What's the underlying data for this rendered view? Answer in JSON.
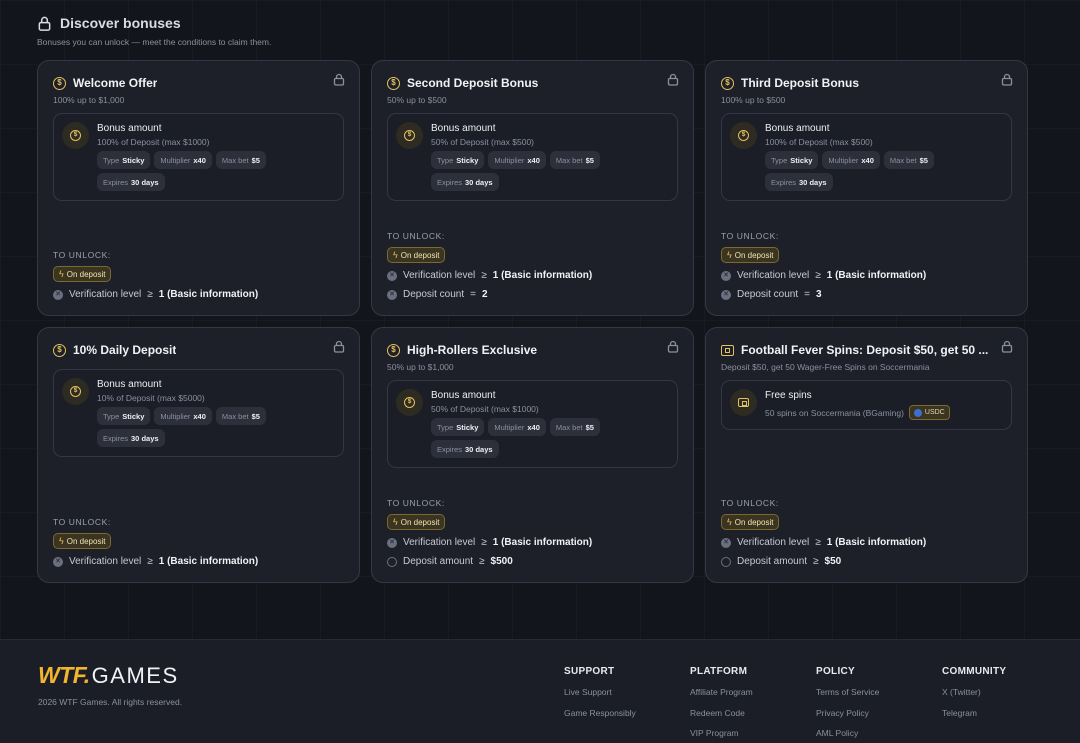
{
  "header": {
    "title": "Discover bonuses",
    "subtitle": "Bonuses you can unlock — meet the conditions to claim them."
  },
  "labels": {
    "to_unlock": "TO UNLOCK:",
    "on_deposit": "On deposit",
    "chip_type": "Type",
    "chip_multiplier": "Multiplier",
    "chip_maxbet": "Max bet",
    "chip_expires": "Expires"
  },
  "cards": [
    {
      "title": "Welcome Offer",
      "subtitle": "100% up to $1,000",
      "bonus_label": "Bonus amount",
      "bonus_desc": "100% of Deposit (max $1000)",
      "type": "Sticky",
      "multiplier": "x40",
      "maxbet": "$5",
      "expires": "30 days",
      "conditions": [
        {
          "label": "Verification level",
          "op": "≥",
          "value": "1 (Basic information)",
          "icon": "x-circle-icon"
        }
      ]
    },
    {
      "title": "Second Deposit Bonus",
      "subtitle": "50% up to $500",
      "bonus_label": "Bonus amount",
      "bonus_desc": "50% of Deposit (max $500)",
      "type": "Sticky",
      "multiplier": "x40",
      "maxbet": "$5",
      "expires": "30 days",
      "conditions": [
        {
          "label": "Verification level",
          "op": "≥",
          "value": "1 (Basic information)",
          "icon": "x-circle-icon"
        },
        {
          "label": "Deposit count",
          "op": "=",
          "value": "2",
          "icon": "x-circle-icon"
        }
      ]
    },
    {
      "title": "Third Deposit Bonus",
      "subtitle": "100% up to $500",
      "bonus_label": "Bonus amount",
      "bonus_desc": "100% of Deposit (max $500)",
      "type": "Sticky",
      "multiplier": "x40",
      "maxbet": "$5",
      "expires": "30 days",
      "conditions": [
        {
          "label": "Verification level",
          "op": "≥",
          "value": "1 (Basic information)",
          "icon": "x-circle-icon"
        },
        {
          "label": "Deposit count",
          "op": "=",
          "value": "3",
          "icon": "x-circle-icon"
        }
      ]
    },
    {
      "title": "10% Daily Deposit",
      "subtitle": "",
      "bonus_label": "Bonus amount",
      "bonus_desc": "10% of Deposit (max $5000)",
      "type": "Sticky",
      "multiplier": "x40",
      "maxbet": "$5",
      "expires": "30 days",
      "conditions": [
        {
          "label": "Verification level",
          "op": "≥",
          "value": "1 (Basic information)",
          "icon": "x-circle-icon"
        }
      ]
    },
    {
      "title": "High-Rollers Exclusive",
      "subtitle": "50% up to $1,000",
      "bonus_label": "Bonus amount",
      "bonus_desc": "50% of Deposit (max $1000)",
      "type": "Sticky",
      "multiplier": "x40",
      "maxbet": "$5",
      "expires": "30 days",
      "conditions": [
        {
          "label": "Verification level",
          "op": "≥",
          "value": "1 (Basic information)",
          "icon": "x-circle-icon"
        },
        {
          "label": "Deposit amount",
          "op": "≥",
          "value": "$500",
          "icon": "empty-circle-icon"
        }
      ]
    },
    {
      "title": "Football Fever Spins: Deposit $50, get 50 ...",
      "subtitle": "Deposit $50, get 50 Wager-Free Spins on Soccermania",
      "bonus_label": "Free spins",
      "bonus_desc": "50 spins on Soccermania (BGaming)",
      "currency": "USDC",
      "conditions": [
        {
          "label": "Verification level",
          "op": "≥",
          "value": "1 (Basic information)",
          "icon": "x-circle-icon"
        },
        {
          "label": "Deposit amount",
          "op": "≥",
          "value": "$50",
          "icon": "empty-circle-icon"
        }
      ]
    }
  ],
  "footer": {
    "logo_wtf": "WTF.",
    "logo_games": "GAMES",
    "copyright": "2026 WTF Games. All rights reserved.",
    "columns": [
      {
        "title": "SUPPORT",
        "links": [
          "Live Support",
          "Game Responsibly"
        ]
      },
      {
        "title": "PLATFORM",
        "links": [
          "Affiliate Program",
          "Redeem Code",
          "VIP Program"
        ]
      },
      {
        "title": "POLICY",
        "links": [
          "Terms of Service",
          "Privacy Policy",
          "AML Policy"
        ]
      },
      {
        "title": "COMMUNITY",
        "links": [
          "X (Twitter)",
          "Telegram"
        ]
      }
    ]
  }
}
